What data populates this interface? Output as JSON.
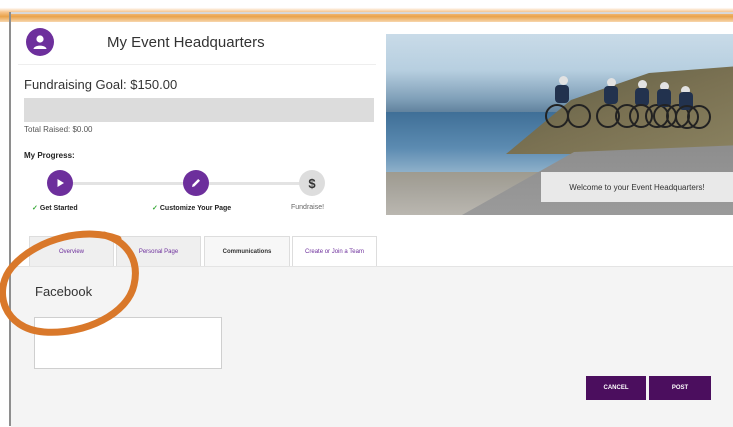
{
  "header": {
    "title": "My Event Headquarters"
  },
  "fundraising": {
    "goal_label": "Fundraising Goal: $150.00",
    "raised_label": "Total Raised: $0.00",
    "progress_fraction": 0.0
  },
  "progress": {
    "heading": "My Progress:",
    "steps": [
      {
        "label": "Get Started",
        "completed": true,
        "icon": "play-icon"
      },
      {
        "label": "Customize Your Page",
        "completed": true,
        "icon": "pencil-icon"
      },
      {
        "label": "Fundraise!",
        "completed": false,
        "icon": "dollar-icon",
        "glyph": "$"
      }
    ]
  },
  "hero": {
    "welcome_text": "Welcome to your Event Headquarters!"
  },
  "tabs": [
    {
      "label": "Overview"
    },
    {
      "label": "Personal Page"
    },
    {
      "label": "Communications",
      "active": true
    },
    {
      "label": "Create or Join a Team"
    }
  ],
  "communications": {
    "section_title": "Facebook",
    "message_value": "",
    "cancel_label": "CANCEL",
    "post_label": "POST"
  },
  "colors": {
    "brand_purple": "#6d2f9c",
    "button_purple": "#4b0e5e",
    "check_green": "#3aa93a",
    "annotation_orange": "#d9782a"
  }
}
